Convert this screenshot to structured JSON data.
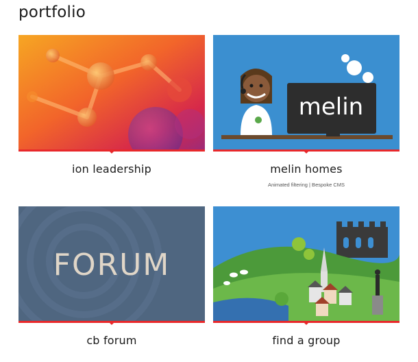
{
  "page": {
    "title": "portfolio"
  },
  "projects": [
    {
      "title": "ion leadership",
      "subtitle": ""
    },
    {
      "title": "melin homes",
      "subtitle": "Animated filtering | Bespoke CMS",
      "logo_text": "melin"
    },
    {
      "title": "cb forum",
      "subtitle": "",
      "logo_text": "FORUM"
    },
    {
      "title": "find a group",
      "subtitle": ""
    }
  ],
  "colors": {
    "accent": "#e8282b",
    "melin_blue": "#3b8fd0",
    "forum_slate": "#4f6680"
  }
}
